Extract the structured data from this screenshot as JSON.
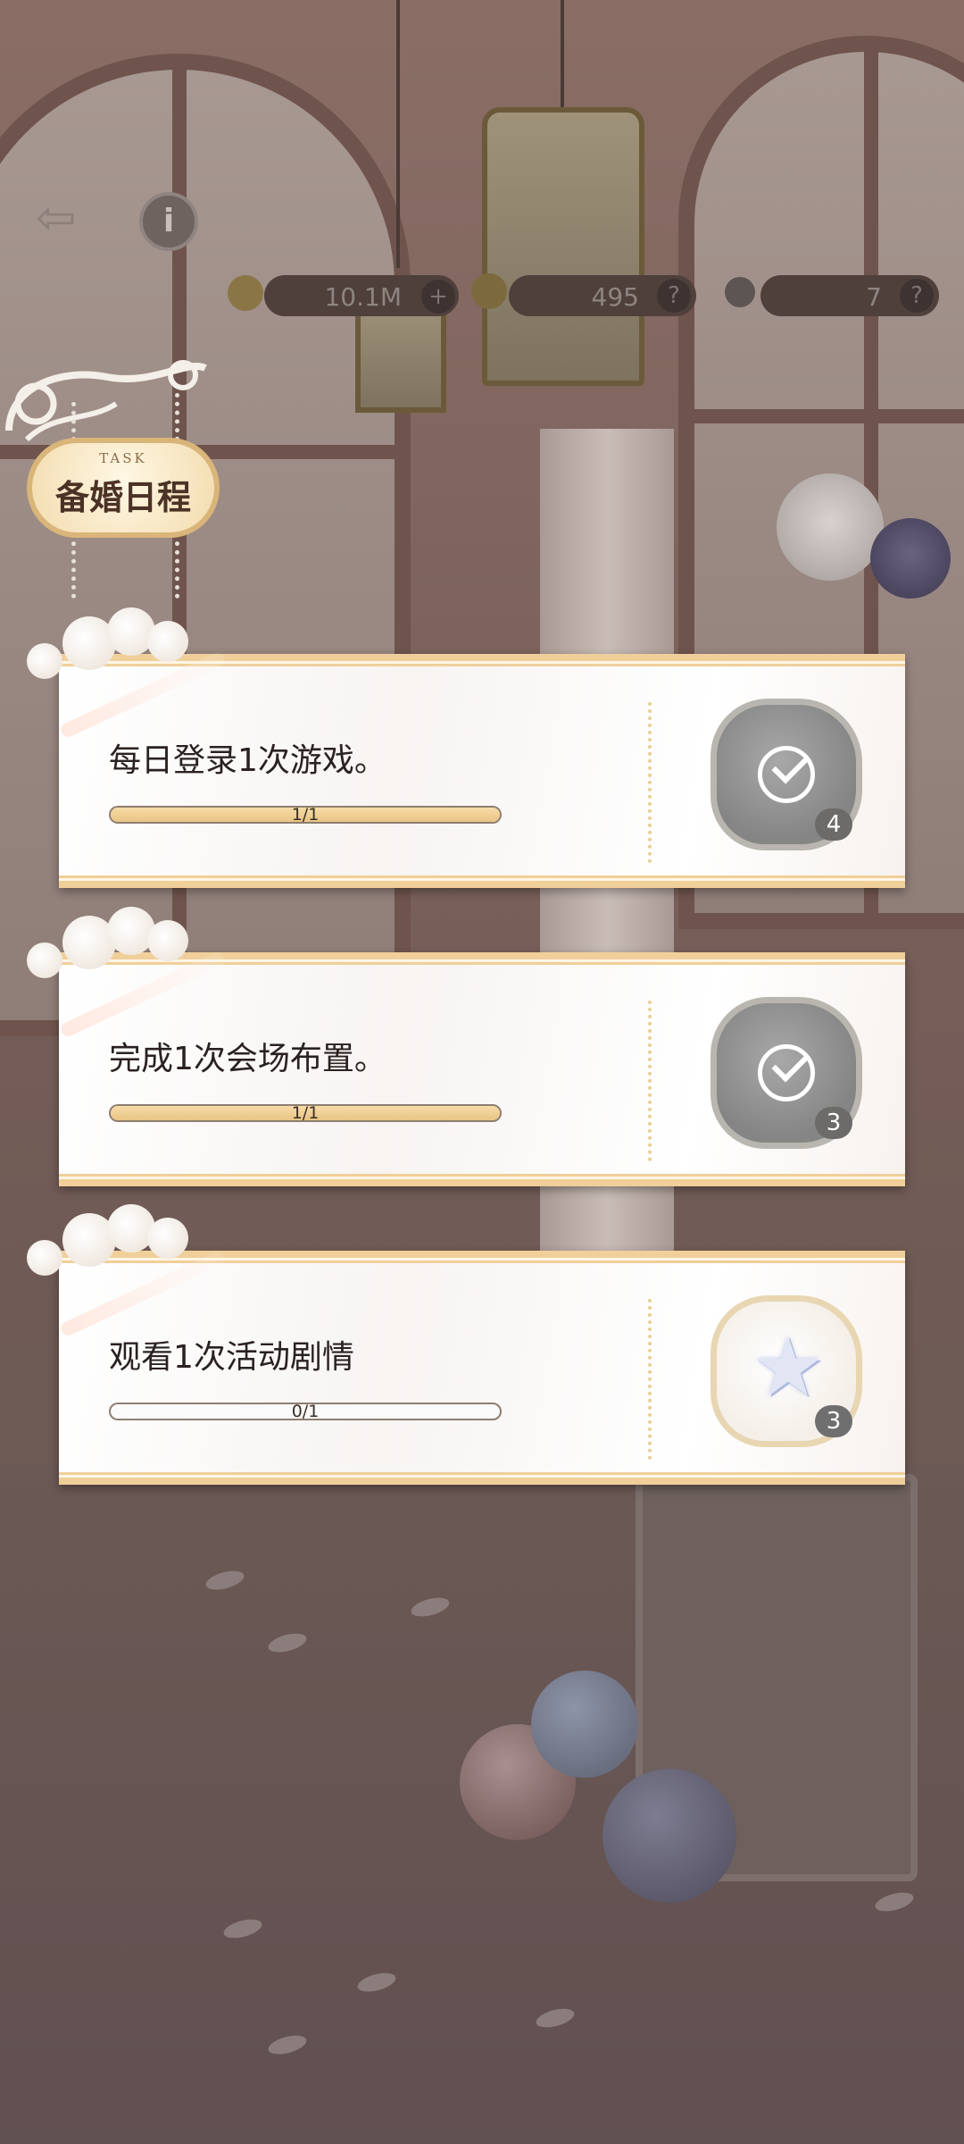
{
  "hud": {
    "back_icon": "back-arrow-icon",
    "info_icon": "info-icon",
    "info_label": "i",
    "currencies": [
      {
        "name": "coins",
        "value": "10.1M",
        "help": "+"
      },
      {
        "name": "gems",
        "value": "495",
        "help": "?"
      },
      {
        "name": "stars",
        "value": "7",
        "help": "?"
      }
    ]
  },
  "panel": {
    "task_label": "TASK",
    "title": "备婚日程"
  },
  "tasks": [
    {
      "text": "每日登录1次游戏。",
      "progress": "1/1",
      "fraction": 1.0,
      "reward": "check-icon",
      "count": "4",
      "status": "completed"
    },
    {
      "text": "完成1次会场布置。",
      "progress": "1/1",
      "fraction": 1.0,
      "reward": "check-icon",
      "count": "3",
      "status": "completed"
    },
    {
      "text": "观看1次活动剧情",
      "progress": "0/1",
      "fraction": 0.0,
      "reward": "star-icon",
      "count": "3",
      "status": "pending"
    }
  ],
  "colors": {
    "card_border": "#f0cf9a",
    "progress_fill": "#e9c584",
    "completed_reward": "#858585"
  }
}
